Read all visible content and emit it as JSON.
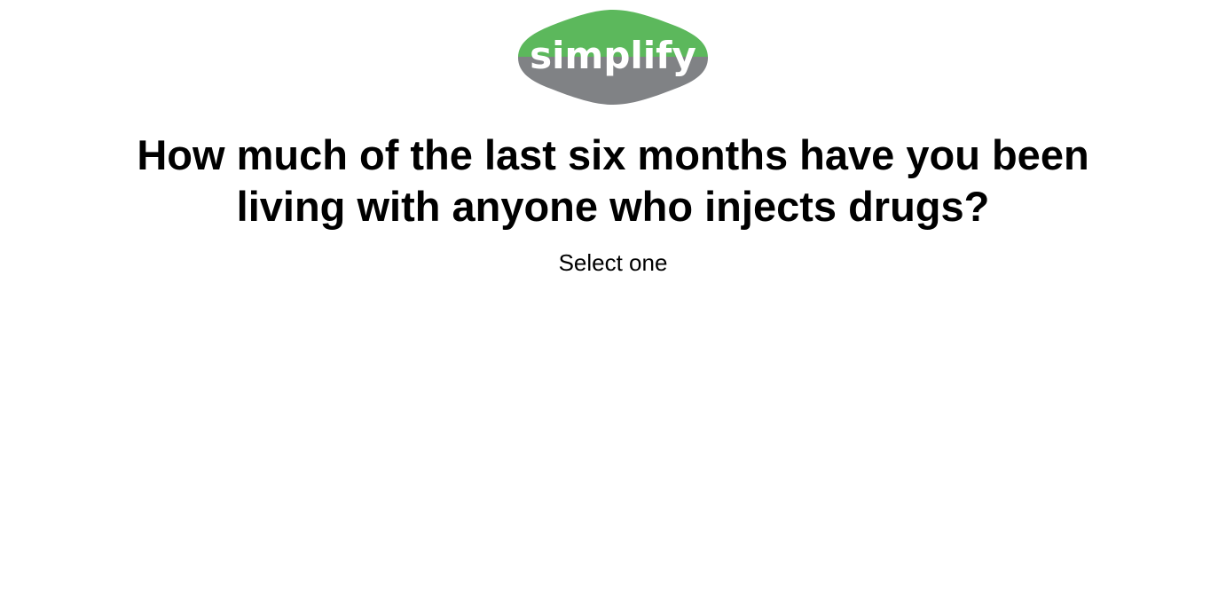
{
  "logo": {
    "text": "simplify",
    "colors": {
      "top": "#5cb85c",
      "bottom": "#808285",
      "text": "#ffffff"
    }
  },
  "question": {
    "line1": "How much of the last six months have you been",
    "line2": "living with anyone who injects drugs?"
  },
  "instruction": "Select one"
}
